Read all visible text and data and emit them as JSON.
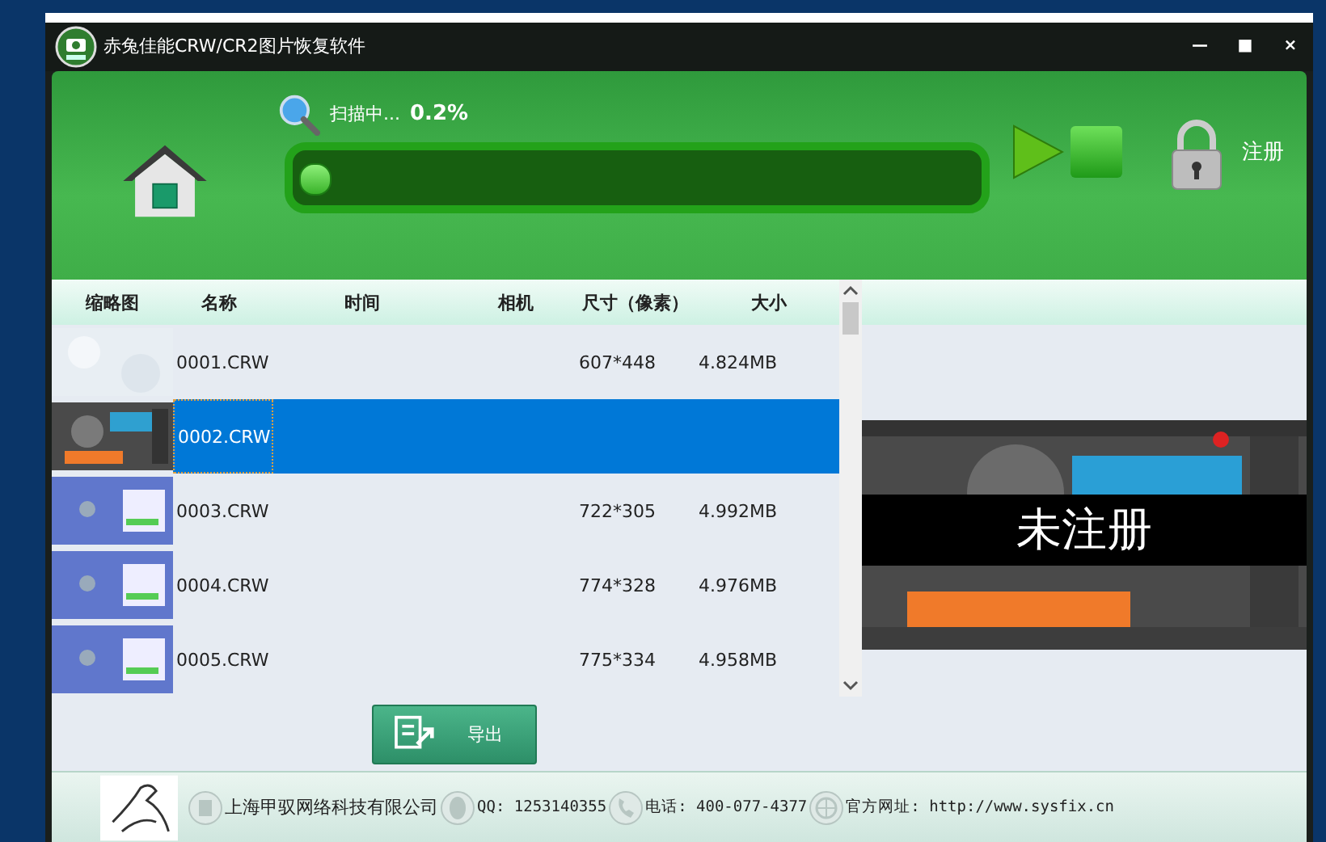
{
  "window": {
    "title": "赤兔佳能CRW/CR2图片恢复软件",
    "controls": [
      "—",
      "■",
      "×"
    ]
  },
  "scan": {
    "status": "扫描中...",
    "percent": "0.2%",
    "level": 0.002
  },
  "register_label": "注册",
  "table": {
    "columns": [
      "缩略图",
      "名称",
      "时间",
      "相机",
      "尺寸（像素）",
      "大小"
    ],
    "rows": [
      {
        "name": "0001.CRW",
        "size": "607*448",
        "filesize": "4.824MB",
        "selected": false
      },
      {
        "name": "0002.CRW",
        "selected": true
      },
      {
        "name": "0003.CRW",
        "size": "722*305",
        "filesize": "4.992MB",
        "selected": false
      },
      {
        "name": "0004.CRW",
        "size": "774*328",
        "filesize": "4.976MB",
        "selected": false
      },
      {
        "name": "0005.CRW",
        "size": "775*334",
        "filesize": "4.958MB",
        "selected": false
      }
    ]
  },
  "preview": {
    "overlay": "未注册"
  },
  "export_button": "导出",
  "footer": {
    "company": "上海甲驭网络科技有限公司",
    "qq": "QQ: 1253140355",
    "phone": "电话: 400-077-4377",
    "website": "官方网址: http://www.sysfix.cn"
  }
}
